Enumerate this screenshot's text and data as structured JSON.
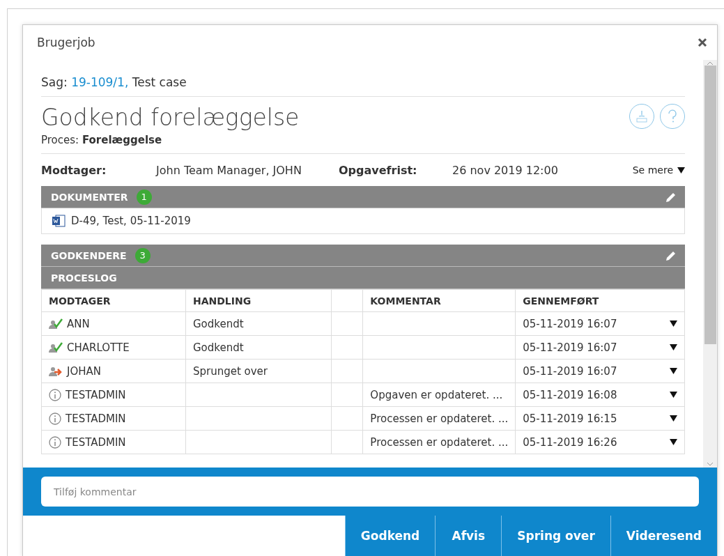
{
  "window": {
    "title": "Brugerjob"
  },
  "case": {
    "label": "Sag:",
    "link": "19-109/1,",
    "name": "Test case"
  },
  "heading": "Godkend forelæggelse",
  "process": {
    "label": "Proces:",
    "value": "Forelæggelse"
  },
  "info": {
    "recipient_label": "Modtager:",
    "recipient": "John Team Manager, JOHN",
    "deadline_label": "Opgavefrist:",
    "deadline": "26 nov 2019 12:00",
    "more": "Se mere"
  },
  "documents": {
    "title": "DOKUMENTER",
    "count": "1",
    "items": [
      "D-49, Test, 05-11-2019"
    ]
  },
  "approvers": {
    "title": "GODKENDERE",
    "count": "3"
  },
  "process_log": {
    "title": "PROCESLOG",
    "columns": [
      "MODTAGER",
      "HANDLING",
      "KOMMENTAR",
      "GENNEMFØRT"
    ],
    "rows": [
      {
        "kind": "approved",
        "recipient": "ANN",
        "action": "Godkendt",
        "comment": "",
        "completed": "05-11-2019 16:07"
      },
      {
        "kind": "approved",
        "recipient": "CHARLOTTE",
        "action": "Godkendt",
        "comment": "",
        "completed": "05-11-2019 16:07"
      },
      {
        "kind": "skipped",
        "recipient": "JOHAN",
        "action": "Sprunget over",
        "comment": "",
        "completed": "05-11-2019 16:07"
      },
      {
        "kind": "info",
        "recipient": "TESTADMIN",
        "action": "",
        "comment": "Opgaven er opdateret. ...",
        "completed": "05-11-2019 16:08"
      },
      {
        "kind": "info",
        "recipient": "TESTADMIN",
        "action": "",
        "comment": "Processen er opdateret. ...",
        "completed": "05-11-2019 16:15"
      },
      {
        "kind": "info",
        "recipient": "TESTADMIN",
        "action": "",
        "comment": "Processen er opdateret. ...",
        "completed": "05-11-2019 16:26"
      }
    ]
  },
  "comment": {
    "placeholder": "Tilføj kommentar"
  },
  "buttons": [
    "Godkend",
    "Afvis",
    "Spring over",
    "Videresend"
  ]
}
